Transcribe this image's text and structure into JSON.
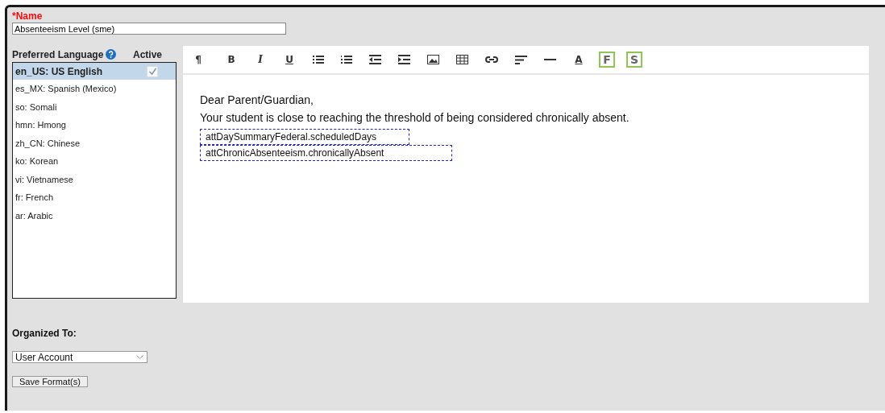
{
  "name_field": {
    "required_mark": "*",
    "label": "Name",
    "value": "Absenteeism Level (sme)"
  },
  "languages": {
    "heading": "Preferred Language",
    "active_heading": "Active",
    "items": [
      {
        "label": "en_US: US English",
        "selected": true,
        "active": true
      },
      {
        "label": "es_MX: Spanish (Mexico)",
        "selected": false
      },
      {
        "label": "so: Somali",
        "selected": false
      },
      {
        "label": "hmn: Hmong",
        "selected": false
      },
      {
        "label": "zh_CN: Chinese",
        "selected": false
      },
      {
        "label": "ko: Korean",
        "selected": false
      },
      {
        "label": "vi: Vietnamese",
        "selected": false
      },
      {
        "label": "fr: French",
        "selected": false
      },
      {
        "label": "ar: Arabic",
        "selected": false
      }
    ]
  },
  "toolbar": [
    {
      "kind": "para",
      "label": "¶"
    },
    {
      "kind": "bold",
      "label": "B"
    },
    {
      "kind": "italic",
      "label": "I"
    },
    {
      "kind": "underline",
      "label": "U"
    },
    {
      "kind": "ul"
    },
    {
      "kind": "ol"
    },
    {
      "kind": "outdent"
    },
    {
      "kind": "indent"
    },
    {
      "kind": "image"
    },
    {
      "kind": "table"
    },
    {
      "kind": "link"
    },
    {
      "kind": "align"
    },
    {
      "kind": "rule"
    },
    {
      "kind": "color",
      "label": "A"
    },
    {
      "kind": "boxed",
      "label": "F"
    },
    {
      "kind": "boxed",
      "label": "S"
    }
  ],
  "editor": {
    "lines": [
      {
        "kind": "text",
        "text": "Dear Parent/Guardian,"
      },
      {
        "kind": "text",
        "text": "Your student is close to reaching the threshold of being considered chronically absent."
      },
      {
        "kind": "field",
        "text": "attDaySummaryFederal.scheduledDays"
      },
      {
        "kind": "field",
        "text": "attChronicAbsenteeism.chronicallyAbsent"
      }
    ]
  },
  "organized_to": {
    "label": "Organized To:",
    "value": "User Account"
  },
  "save_button": "Save Format(s)"
}
